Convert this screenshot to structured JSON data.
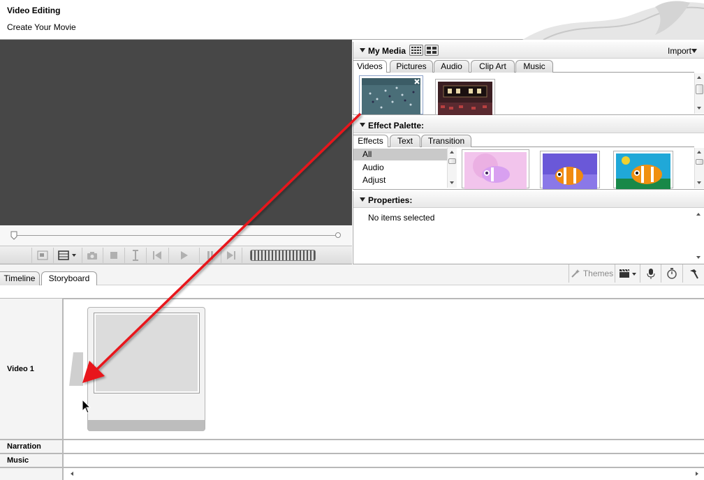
{
  "header": {
    "title": "Video Editing",
    "subtitle": "Create Your Movie"
  },
  "preview": {
    "controls": [
      "fullscreen-icon",
      "view-options-icon",
      "camera-icon",
      "stop-icon",
      "split-icon",
      "previous-frame-icon",
      "play-icon",
      "pause-icon",
      "next-frame-icon"
    ]
  },
  "my_media": {
    "title": "My Media",
    "import_label": "Import",
    "tabs": [
      "Videos",
      "Pictures",
      "Audio",
      "Clip Art",
      "Music"
    ],
    "active_tab": "Videos"
  },
  "effect_palette": {
    "title": "Effect Palette:",
    "tabs": [
      "Effects",
      "Text",
      "Transition"
    ],
    "active_tab": "Effects",
    "list": [
      "All",
      "Audio",
      "Adjust"
    ],
    "selected": "All"
  },
  "properties": {
    "title": "Properties:",
    "empty_text": "No items selected"
  },
  "view_tabs": [
    "Timeline",
    "Storyboard"
  ],
  "active_view": "Storyboard",
  "toolbar": {
    "themes_label": "Themes"
  },
  "tracks": {
    "video": "Video 1",
    "narration": "Narration",
    "music": "Music"
  },
  "colors": {
    "preview_bg": "#474747",
    "annotation_arrow": "#e8161a"
  }
}
